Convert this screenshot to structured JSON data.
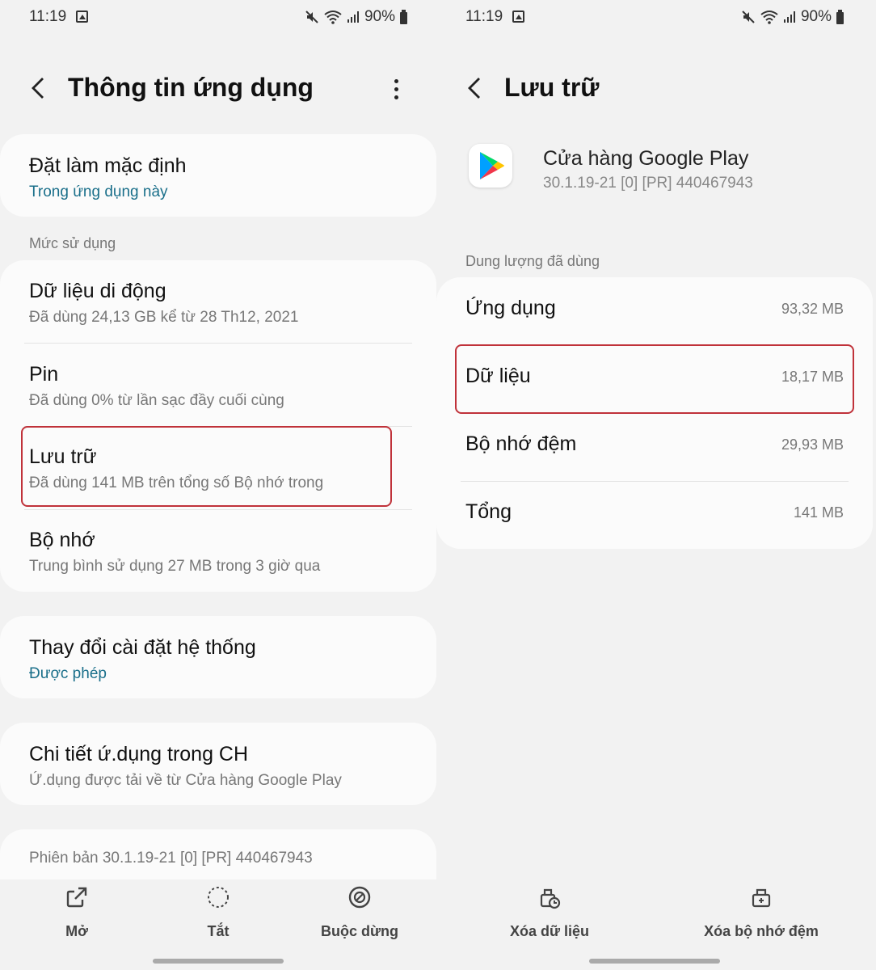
{
  "status": {
    "time": "11:19",
    "battery": "90%"
  },
  "left": {
    "title": "Thông tin ứng dụng",
    "default": {
      "title": "Đặt làm mặc định",
      "sub": "Trong ứng dụng này"
    },
    "usage_label": "Mức sử dụng",
    "usage_items": [
      {
        "title": "Dữ liệu di động",
        "sub": "Đã dùng 24,13 GB kể từ 28 Th12, 2021"
      },
      {
        "title": "Pin",
        "sub": "Đã dùng 0% từ lần sạc đầy cuối cùng"
      },
      {
        "title": "Lưu trữ",
        "sub": "Đã dùng 141 MB trên tổng số Bộ nhớ trong"
      },
      {
        "title": "Bộ nhớ",
        "sub": "Trung bình sử dụng 27 MB trong 3 giờ qua"
      }
    ],
    "system": {
      "title": "Thay đổi cài đặt hệ thống",
      "sub": "Được phép"
    },
    "store": {
      "title": "Chi tiết ứ.dụng trong CH",
      "sub": "Ứ.dụng được tải về từ Cửa hàng Google Play"
    },
    "version": "Phiên bản 30.1.19-21 [0] [PR] 440467943",
    "buttons": {
      "open": "Mở",
      "disable": "Tắt",
      "force_stop": "Buộc dừng"
    }
  },
  "right": {
    "title": "Lưu trữ",
    "app_name": "Cửa hàng Google Play",
    "app_version": "30.1.19-21 [0] [PR] 440467943",
    "section_label": "Dung lượng đã dùng",
    "rows": [
      {
        "label": "Ứng dụng",
        "value": "93,32 MB"
      },
      {
        "label": "Dữ liệu",
        "value": "18,17 MB"
      },
      {
        "label": "Bộ nhớ đệm",
        "value": "29,93 MB"
      },
      {
        "label": "Tổng",
        "value": "141 MB"
      }
    ],
    "buttons": {
      "clear_data": "Xóa dữ liệu",
      "clear_cache": "Xóa bộ nhớ đệm"
    }
  },
  "colors": {
    "highlight": "#c0323a",
    "link": "#1a6f8a",
    "background": "#f2f2f2",
    "card": "#fbfbfb"
  }
}
